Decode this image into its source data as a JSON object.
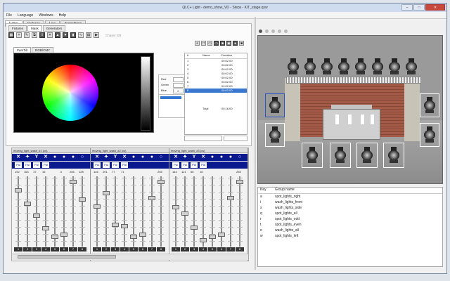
{
  "window": {
    "title": "QLC+ Light - demo_show_VD - Steps - KIT_stage.qxw",
    "min": "–",
    "max": "□",
    "close": "✕"
  },
  "menu": [
    "File",
    "Language",
    "Windows",
    "Help"
  ],
  "tabs": [
    "Editor",
    "Fixtures",
    "Live",
    "Transitions"
  ],
  "subtabs": [
    "Fixtures",
    "Mask",
    "Generators"
  ],
  "picker_tabs": [
    "Pan/Tilt",
    "RGB/CMY"
  ],
  "toolbar": {
    "extra": "Chaser GR"
  },
  "rgb": {
    "labels": [
      "Red",
      "Green",
      "Blue"
    ],
    "values": [
      "",
      "",
      "0"
    ]
  },
  "cue_list": {
    "headers": [
      "#",
      "Name",
      "Duration"
    ],
    "rows": [
      {
        "n": "1",
        "name": "",
        "dur": "00:02.00"
      },
      {
        "n": "2",
        "name": "",
        "dur": "00:02.00"
      },
      {
        "n": "3",
        "name": "",
        "dur": "00:02.00"
      },
      {
        "n": "4",
        "name": "",
        "dur": "00:02.00"
      },
      {
        "n": "5",
        "name": "",
        "dur": "00:02.00"
      },
      {
        "n": "6",
        "name": "",
        "dur": "00:02.00"
      },
      {
        "n": "7",
        "name": "",
        "dur": "00:02.00"
      },
      {
        "n": "8",
        "name": "",
        "dur": "00:02.00"
      }
    ],
    "total_label": "Total",
    "total": "00:16.00"
  },
  "groups": {
    "headers": [
      "Key",
      "Group name"
    ],
    "rows": [
      {
        "key": "a",
        "name": "spot_lights_right"
      },
      {
        "key": "i",
        "name": "wash_lights_front"
      },
      {
        "key": "s",
        "name": "wash_lights_side"
      },
      {
        "key": "q",
        "name": "spot_lights_all"
      },
      {
        "key": "r",
        "name": "spot_lights_odd"
      },
      {
        "key": "t",
        "name": "spot_lights_even"
      },
      {
        "key": "o",
        "name": "wash_lights_all"
      },
      {
        "key": "w",
        "name": "spot_lights_left"
      }
    ]
  },
  "fader_groups": [
    {
      "title": "moving_light_wash_#1 (cs)",
      "pal": [
        "Pal",
        "Pal",
        "Pal",
        "Pal"
      ],
      "dmx": [
        "192",
        "164",
        "72",
        "16",
        "",
        "0",
        "255",
        "128"
      ],
      "levels": [
        0.82,
        0.62,
        0.44,
        0.25,
        0.12,
        0.15,
        0.95,
        0.68
      ]
    },
    {
      "title": "moving_light_wash_#2 (cs)",
      "pal": [
        "Pal",
        "Pal",
        "Pal",
        "Pal"
      ],
      "dmx": [
        "146",
        "201",
        "77",
        "71",
        "",
        "",
        "",
        "255"
      ],
      "levels": [
        0.57,
        0.78,
        0.3,
        0.28,
        0.12,
        0.15,
        0.7,
        0.95
      ]
    },
    {
      "title": "moving_light_wash_#3 (cs)",
      "pal": [
        "Pal",
        "Pal",
        "Pal",
        "Pal"
      ],
      "dmx": [
        "144",
        "121",
        "66",
        "16",
        "",
        "",
        "",
        "255"
      ],
      "levels": [
        0.56,
        0.47,
        0.26,
        0.06,
        0.12,
        0.15,
        0.7,
        0.95
      ]
    }
  ],
  "channel_numbers": [
    "1",
    "2",
    "3",
    "4",
    "5",
    "6",
    "7",
    "8"
  ],
  "colors": {
    "accent": "#3a78cf",
    "fixture_icon_bar": "#0a1a8e",
    "selected_fixture": "#2a53c8"
  }
}
